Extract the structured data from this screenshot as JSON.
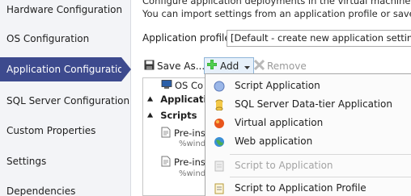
{
  "sidebar": {
    "items": [
      {
        "label": "Hardware Configuration"
      },
      {
        "label": "OS Configuration"
      },
      {
        "label": "Application Configuration"
      },
      {
        "label": "SQL Server Configuration"
      },
      {
        "label": "Custom Properties"
      },
      {
        "label": "Settings"
      },
      {
        "label": "Dependencies"
      }
    ],
    "active_index": 2
  },
  "main": {
    "description_line1": "Configure application deployments in the virtual machine. Dep",
    "description_line2": "You can import settings from an application profile or save a n",
    "profile_label": "Application profile:",
    "profile_value": "[Default - create new application settings]"
  },
  "toolbar": {
    "save_label": "Save As...",
    "add_label": "Add",
    "remove_label": "Remove"
  },
  "tree": {
    "os_item": "OS Co",
    "applications_header": "Applicatio",
    "scripts_header": "Scripts",
    "script1_title": "Pre-ins",
    "script1_sub": "%windir",
    "script2_title": "Pre-ins",
    "script2_sub": "%windir"
  },
  "add_menu": {
    "items": [
      {
        "label": "Script Application",
        "icon": "script-application-icon",
        "enabled": true
      },
      {
        "label": "SQL Server Data-tier Application",
        "icon": "sql-data-tier-icon",
        "enabled": true
      },
      {
        "label": "Virtual application",
        "icon": "virtual-application-icon",
        "enabled": true
      },
      {
        "label": "Web application",
        "icon": "web-application-icon",
        "enabled": true
      },
      {
        "label": "Script to Application",
        "icon": "script-to-application-icon",
        "enabled": false
      },
      {
        "label": "Script to Application Profile",
        "icon": "script-to-profile-icon",
        "enabled": true
      }
    ]
  },
  "colors": {
    "accent": "#3d4a8e",
    "sidebar_bg": "#f3f4f7",
    "disabled_text": "#a3a3a3"
  }
}
